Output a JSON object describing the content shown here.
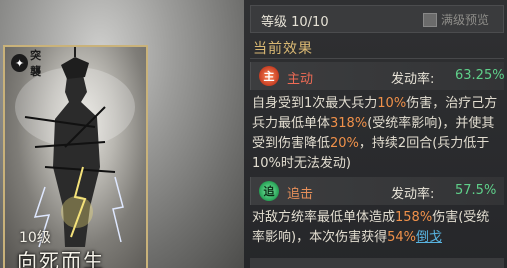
{
  "card": {
    "tag": "突襲",
    "level": "10级",
    "name": "向死而生"
  },
  "header": {
    "level": "等级 10/10",
    "max_preview": "满级预览"
  },
  "section_title": "当前效果",
  "skills": [
    {
      "type": "主动",
      "badge": "主",
      "rate_label": "发动率:",
      "rate_value": "63.25%",
      "desc": [
        {
          "t": "自身受到1次最大兵力"
        },
        {
          "t": "10%",
          "c": "orange"
        },
        {
          "t": "伤害，治疗己方兵力最低单体"
        },
        {
          "t": "318%",
          "c": "orange"
        },
        {
          "t": "(受统率影响)，并使其受到伤害降低"
        },
        {
          "t": "20%",
          "c": "orange"
        },
        {
          "t": "，持续2回合(兵力低于10%时无法发动)"
        }
      ]
    },
    {
      "type": "追击",
      "badge": "追",
      "rate_label": "发动率:",
      "rate_value": "57.5%",
      "desc": [
        {
          "t": "对敌方统率最低单体造成"
        },
        {
          "t": "158%",
          "c": "orange"
        },
        {
          "t": "伤害(受统率影响)，本次伤害获得"
        },
        {
          "t": "54%",
          "c": "orange"
        },
        {
          "t": "倒戈",
          "c": "blue"
        }
      ]
    }
  ],
  "colors": {
    "accent_gold": "#d9b873",
    "rate_green": "#5fd08a",
    "highlight_orange": "#f0914a",
    "link_blue": "#58b3e0"
  }
}
